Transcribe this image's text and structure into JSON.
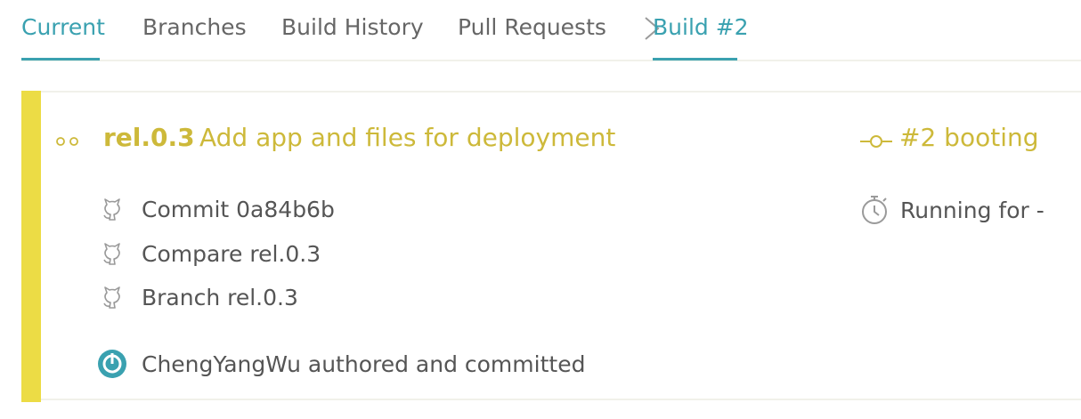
{
  "tabs": [
    {
      "label": "Current",
      "active": true
    },
    {
      "label": "Branches",
      "active": false
    },
    {
      "label": "Build History",
      "active": false
    },
    {
      "label": "Pull Requests",
      "active": false
    }
  ],
  "breadcrumb": {
    "separator_icon": "chevron-right-icon",
    "current": "Build #2"
  },
  "build": {
    "status_color": "#ecdc45",
    "branch": "rel.0.3",
    "message": "Add app and files for deployment",
    "state_label": "#2 booting",
    "commit_label": "Commit 0a84b6b",
    "compare_label": "Compare rel.0.3",
    "branch_label": "Branch rel.0.3",
    "author_label": "ChengYangWu authored and committed",
    "duration_label": "Running for -"
  },
  "colors": {
    "accent": "#3aa1b0",
    "started": "#cdb93a",
    "text": "#555555"
  },
  "icons": {
    "status": "dots-icon",
    "state": "commit-node-icon",
    "repo": "github-icon",
    "duration": "stopwatch-icon",
    "avatar": "avatar-icon"
  }
}
